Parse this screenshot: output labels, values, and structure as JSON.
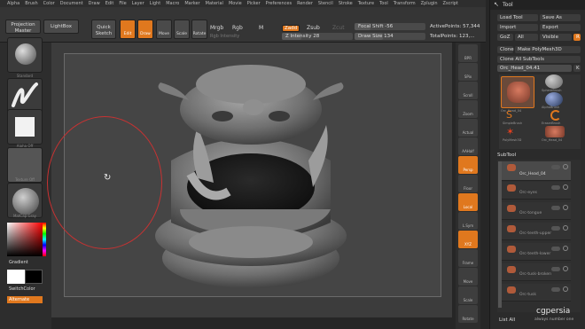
{
  "menu": [
    "Alpha",
    "Brush",
    "Color",
    "Document",
    "Draw",
    "Edit",
    "File",
    "Layer",
    "Light",
    "Macro",
    "Marker",
    "Material",
    "Movie",
    "Picker",
    "Preferences",
    "Render",
    "Stencil",
    "Stroke",
    "Texture",
    "Tool",
    "Transform",
    "Zplugin",
    "Zscript"
  ],
  "topbar": {
    "projection_master": "Projection Master",
    "lightbox": "LightBox",
    "quick_sketch": "Quick Sketch",
    "edit": "Edit",
    "draw": "Draw",
    "move": "Move",
    "scale": "Scale",
    "rotate": "Rotate",
    "mrgb": "Mrgb",
    "rgb": "Rgb",
    "m": "M",
    "rgb_intensity": "Rgb Intensity",
    "zadd": "Zadd",
    "zsub": "Zsub",
    "zcut": "Zcut",
    "z_intensity_label": "Z Intensity",
    "z_intensity_value": "28",
    "focal_shift_label": "Focal Shift",
    "focal_shift_value": "-56",
    "draw_size_label": "Draw Size",
    "draw_size_value": "134",
    "active_points": "ActivePoints: 57,344",
    "total_points": "TotalPoints: 123,..."
  },
  "left": {
    "brush_label": "Standard",
    "stroke_label": "FreeHand",
    "alpha_label": "Alpha Off",
    "texture_label": "Texture Off",
    "material_label": "MatCap Gray",
    "gradient_label": "Gradient",
    "switch_color_label": "SwitchColor",
    "alternate_label": "Alternate",
    "rotate_icon": "rotate-icon"
  },
  "right_tray": [
    "BPR",
    "SPix",
    "Scroll",
    "Zoom",
    "Actual",
    "AAHalf",
    "Persp",
    "Floor",
    "Local",
    "L.Sym",
    "XYZ",
    "Frame",
    "Move",
    "Scale",
    "Rotate"
  ],
  "tool_panel": {
    "title": "Tool",
    "load_tool": "Load Tool",
    "save_as": "Save As",
    "import": "Import",
    "export": "Export",
    "goz": "GoZ",
    "all": "All",
    "visible": "Visible",
    "r": "R",
    "clone": "Clone",
    "make_polymesh": "Make PolyMesh3D",
    "clone_all_subtools": "Clone All SubTools",
    "current_tool": "Orc_Head_04.41",
    "k": "K",
    "tools": [
      "Orc_Head_04",
      "SphereBrush",
      "AlphaBrush",
      "SimpleBrush",
      "EraserBrush",
      "PolyMesh3D",
      "Orc_Head_04"
    ],
    "subtool_header": "SubTool",
    "subtools": [
      "Orc_Head_04",
      "Orc-eyes",
      "Orc-tongue",
      "Orc-teeth-upper",
      "Orc-teeth-lower",
      "Orc-tusk-broken",
      "Orc-tusk"
    ],
    "list_all": "List All",
    "watermark": "cgpersia",
    "watermark_sub": "always number one"
  },
  "colors": {
    "accent": "#e0781e",
    "brush_ring": "#c83232"
  }
}
